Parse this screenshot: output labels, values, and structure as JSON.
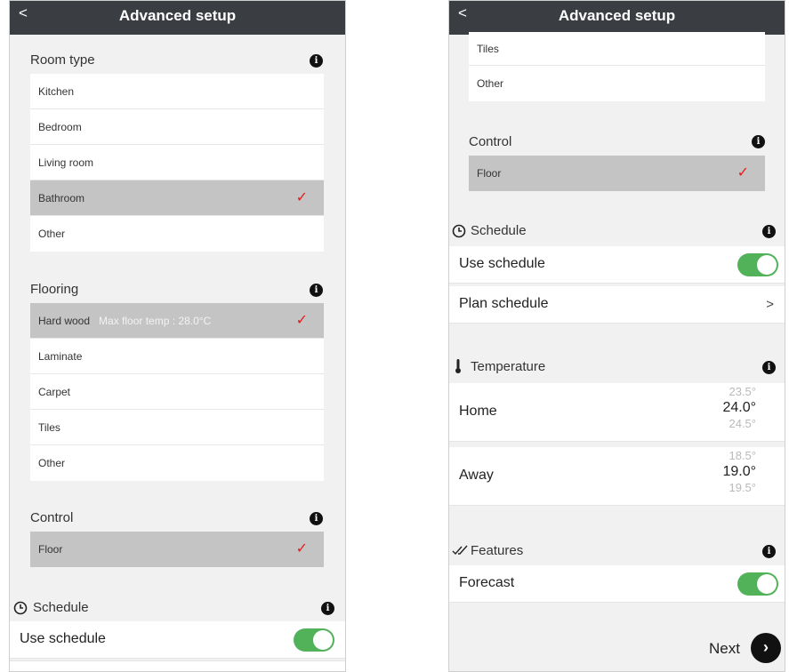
{
  "left": {
    "nav": {
      "back": "<",
      "title": "Advanced setup"
    },
    "room_type": {
      "title": "Room type",
      "options": [
        {
          "label": "Kitchen"
        },
        {
          "label": "Bedroom"
        },
        {
          "label": "Living room"
        },
        {
          "label": "Bathroom",
          "selected": true,
          "check": "✓"
        },
        {
          "label": "Other"
        }
      ]
    },
    "flooring": {
      "title": "Flooring",
      "options": [
        {
          "label": "Hard wood",
          "note": "Max floor temp : 28.0°C",
          "selected": true,
          "check": "✓"
        },
        {
          "label": "Laminate"
        },
        {
          "label": "Carpet"
        },
        {
          "label": "Tiles"
        },
        {
          "label": "Other"
        }
      ]
    },
    "control": {
      "title": "Control",
      "option": "Floor",
      "check": "✓"
    },
    "schedule": {
      "title": "Schedule",
      "use_schedule": "Use schedule",
      "use_schedule_on": true
    }
  },
  "right": {
    "nav": {
      "back": "<",
      "title": "Advanced setup"
    },
    "flooring_tail": [
      {
        "label": "Tiles"
      },
      {
        "label": "Other"
      }
    ],
    "control": {
      "title": "Control",
      "option": "Floor",
      "check": "✓"
    },
    "schedule": {
      "title": "Schedule",
      "use_schedule": "Use schedule",
      "use_schedule_on": true,
      "plan_schedule": "Plan schedule",
      "chevron": ">"
    },
    "temperature": {
      "title": "Temperature",
      "home": {
        "label": "Home",
        "above": "23.5°",
        "value": "24.0°",
        "below": "24.5°"
      },
      "away": {
        "label": "Away",
        "above": "18.5°",
        "value": "19.0°",
        "below": "19.5°"
      }
    },
    "features": {
      "title": "Features",
      "forecast": "Forecast",
      "forecast_on": true
    },
    "next": {
      "label": "Next",
      "arrow": "›"
    }
  },
  "colors": {
    "navbar": "#3a3d42",
    "selected_row": "#c4c4c4",
    "check": "#e02020",
    "toggle_on": "#52b25a",
    "background": "#f1f1f1"
  },
  "icons": [
    "info-icon",
    "clock-icon",
    "thermometer-icon",
    "features-icon",
    "check-icon",
    "chevron-right-icon",
    "back-icon",
    "next-arrow-icon"
  ]
}
